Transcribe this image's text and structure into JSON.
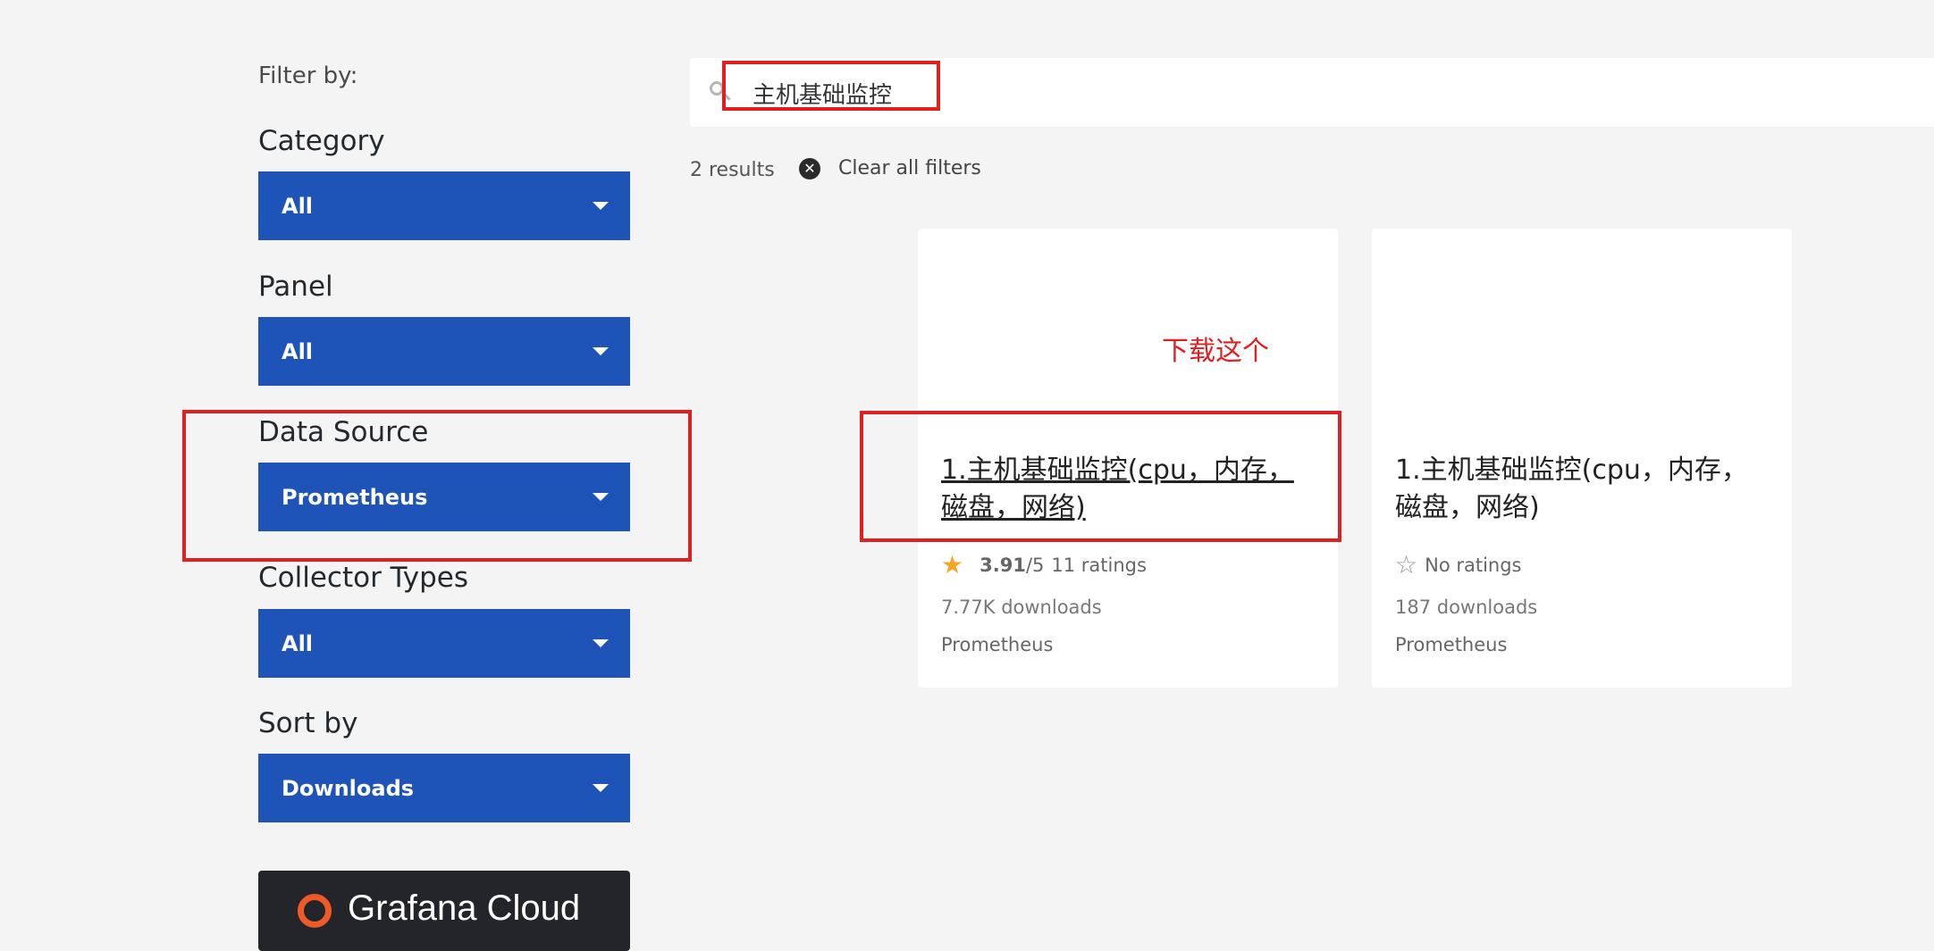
{
  "sidebar": {
    "filter_by": "Filter by:",
    "filters": [
      {
        "label": "Category",
        "value": "All"
      },
      {
        "label": "Panel",
        "value": "All"
      },
      {
        "label": "Data Source",
        "value": "Prometheus"
      },
      {
        "label": "Collector Types",
        "value": "All"
      },
      {
        "label": "Sort by",
        "value": "Downloads"
      }
    ],
    "promo_text": "Grafana Cloud"
  },
  "search": {
    "value": "主机基础监控",
    "icon": "search-icon"
  },
  "results_count": "2 results",
  "clear_filters": {
    "label": "Clear all filters",
    "icon": "close-circle-icon"
  },
  "cards": [
    {
      "title": "1.主机基础监控(cpu，内存，磁盘，网络)",
      "rating_value": "3.91",
      "rating_max": "/5",
      "rating_count": "11 ratings",
      "rating_icon": "star-filled-icon",
      "downloads": "7.77K downloads",
      "datasource": "Prometheus"
    },
    {
      "title": "1.主机基础监控(cpu，内存，磁盘，网络)",
      "rating_text": "No ratings",
      "rating_icon": "star-empty-icon",
      "downloads": "187 downloads",
      "datasource": "Prometheus"
    }
  ],
  "annotation": {
    "text": "下载这个",
    "color": "#e02020"
  },
  "colors": {
    "select_bg": "#1e54b7",
    "page_bg": "#f4f4f4",
    "star": "#f5a623"
  }
}
